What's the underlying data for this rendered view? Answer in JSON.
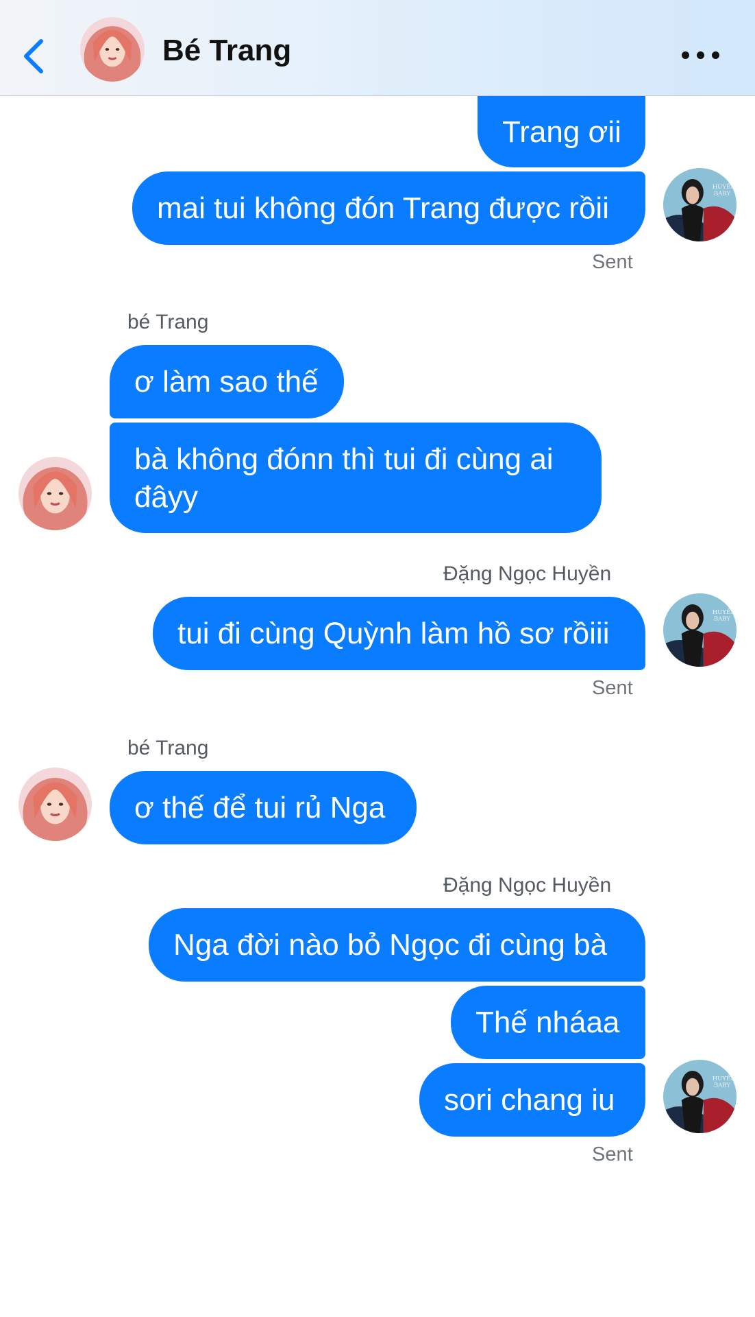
{
  "header": {
    "title": "Bé Trang",
    "back_icon": "chevron-left-icon",
    "more_icon": "more-dots-icon"
  },
  "colors": {
    "bubble": "#0a7cff",
    "accent": "#0a7cff"
  },
  "messages": [
    {
      "text": "Trang ơii"
    },
    {
      "text": "mai tui không đón Trang được rồii"
    },
    {
      "status": "Sent"
    },
    {
      "sender": "bé Trang"
    },
    {
      "text": "ơ làm sao thế"
    },
    {
      "text": "bà không đónn thì tui đi cùng ai đâyy"
    },
    {
      "sender": "Đặng Ngọc Huyền"
    },
    {
      "text": "tui đi cùng Quỳnh làm hồ sơ rồiii"
    },
    {
      "status": "Sent"
    },
    {
      "sender": "bé Trang"
    },
    {
      "text": "ơ thế để tui rủ Nga"
    },
    {
      "sender": "Đặng Ngọc Huyền"
    },
    {
      "text": "Nga đời nào bỏ Ngọc đi cùng bà"
    },
    {
      "text": "Thế nháaa"
    },
    {
      "text": "sori chang iu"
    },
    {
      "status": "Sent"
    }
  ]
}
